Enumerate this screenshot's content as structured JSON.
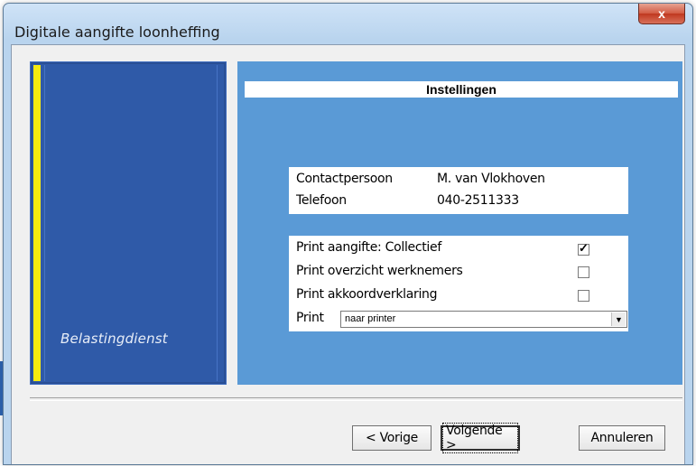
{
  "window": {
    "title": "Digitale aangifte loonheffing",
    "close_glyph": "x"
  },
  "brand": "Belastingdienst",
  "panel": {
    "header": "Instellingen",
    "contact": [
      {
        "label": "Contactpersoon",
        "value": "M. van Vlokhoven"
      },
      {
        "label": "Telefoon",
        "value": "040-2511333"
      }
    ],
    "options": [
      {
        "label": "Print aangifte: Collectief",
        "checked": true
      },
      {
        "label": "Print overzicht werknemers",
        "checked": false
      },
      {
        "label": "Print akkoordverklaring",
        "checked": false
      }
    ],
    "print": {
      "label": "Print",
      "selected": "naar printer"
    }
  },
  "buttons": {
    "back": "< Vorige",
    "next": "Volgende >",
    "cancel": "Annuleren"
  },
  "colors": {
    "panel_blue": "#5a9ad6",
    "brand_blue": "#2f5aa8",
    "accent_yellow": "#f7ea10"
  }
}
